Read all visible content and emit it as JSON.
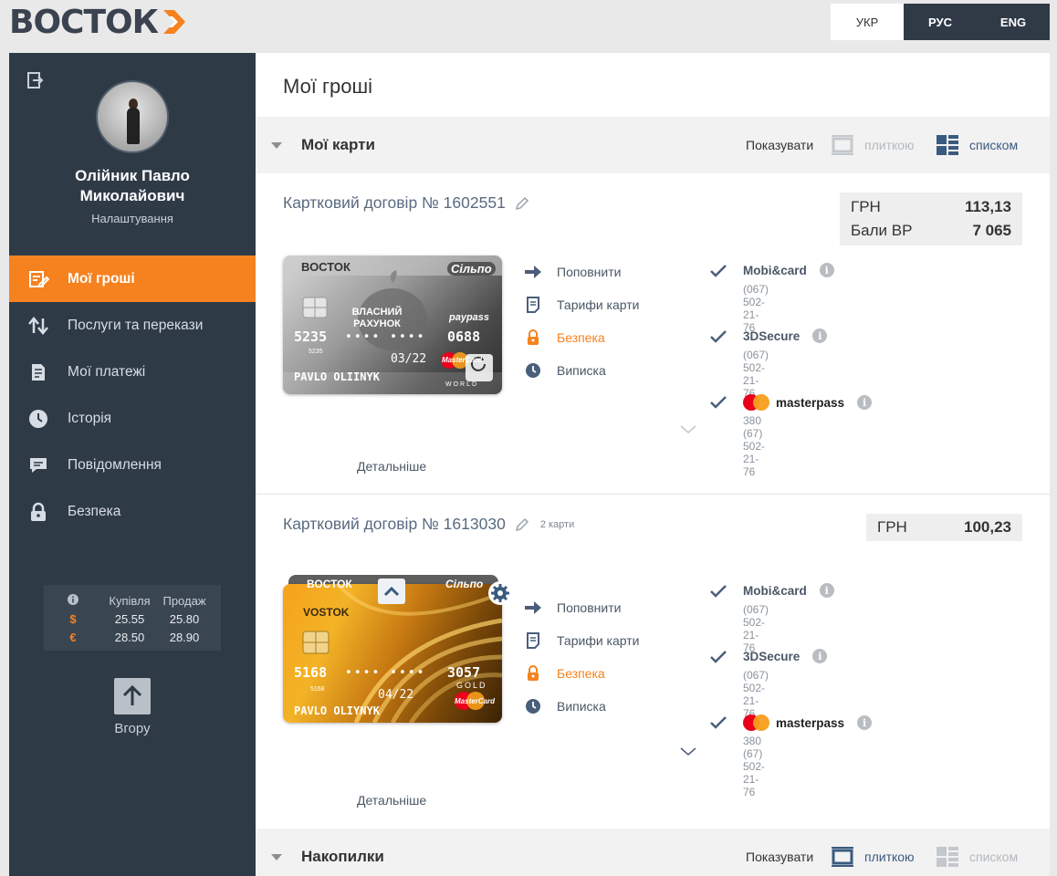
{
  "header": {
    "logo_text": "ВОСТОК",
    "languages": [
      {
        "label": "УКР",
        "active": true
      },
      {
        "label": "РУС",
        "active": false
      },
      {
        "label": "ENG",
        "active": false
      }
    ]
  },
  "sidebar": {
    "user_name_line1": "Олійник Павло",
    "user_name_line2": "Миколайович",
    "settings_label": "Налаштування",
    "nav": [
      {
        "label": "Мої гроші",
        "icon": "money-icon",
        "active": true
      },
      {
        "label": "Послуги та перекази",
        "icon": "transfer-icon",
        "active": false
      },
      {
        "label": "Мої платежі",
        "icon": "payments-icon",
        "active": false
      },
      {
        "label": "Історія",
        "icon": "clock-icon",
        "active": false
      },
      {
        "label": "Повідомлення",
        "icon": "message-icon",
        "active": false
      },
      {
        "label": "Безпека",
        "icon": "lock-icon",
        "active": false
      }
    ],
    "rates": {
      "buy_label": "Купівля",
      "sell_label": "Продаж",
      "rows": [
        {
          "currency": "$",
          "buy": "25.55",
          "sell": "25.80"
        },
        {
          "currency": "€",
          "buy": "28.50",
          "sell": "28.90"
        }
      ]
    },
    "up_label": "Вгору"
  },
  "main": {
    "page_title": "Мої гроші",
    "show_label": "Показувати",
    "tile_label": "плиткою",
    "list_label": "списком",
    "sections": {
      "cards_title": "Мої карти",
      "savings_title": "Накопилки"
    },
    "contracts": [
      {
        "title": "Картковий договір № 1602551",
        "cards_count": "",
        "balances": [
          {
            "label": "ГРН",
            "amount": "113,13"
          },
          {
            "label": "Бали ВР",
            "amount": "7 065"
          }
        ],
        "card": {
          "brand": "ВОСТОК",
          "partner": "Сільпо",
          "product": "ВЛАСНИЙ РАХУНОК",
          "paypass": "paypass",
          "number_first": "5235",
          "number_last": "0688",
          "bin_small": "5235",
          "valid_thru": "03/22",
          "holder": "PAVLO OLIINYK",
          "network": "MasterCard",
          "tier": "WORLD"
        },
        "actions": [
          "Поповнити",
          "Тарифи карти",
          "Безпека",
          "Виписка"
        ],
        "services": [
          {
            "name": "Mobi&card",
            "phone": "(067) 502-21-76"
          },
          {
            "name": "3DSecure",
            "phone": "(067) 502-21-76"
          },
          {
            "name": "masterpass",
            "phone": "380 (67) 502-21-76"
          }
        ],
        "details_label": "Детальніше"
      },
      {
        "title": "Картковий договір № 1613030",
        "cards_count": "2 карти",
        "balances": [
          {
            "label": "ГРН",
            "amount": "100,23"
          }
        ],
        "card": {
          "brand": "ВОСТОК",
          "brand_latin": "VOSTOK",
          "partner": "Сільпо",
          "number_first": "5168",
          "number_last": "3057",
          "bin_small": "5168",
          "valid_thru": "04/22",
          "holder": "PAVLO OLIYNYK",
          "network": "MasterCard",
          "tier": "GOLD"
        },
        "actions": [
          "Поповнити",
          "Тарифи карти",
          "Безпека",
          "Виписка"
        ],
        "services": [
          {
            "name": "Mobi&card",
            "phone": "(067) 502-21-76"
          },
          {
            "name": "3DSecure",
            "phone": "(067) 502-21-76"
          },
          {
            "name": "masterpass",
            "phone": "380 (67) 502-21-76"
          }
        ],
        "details_label": "Детальніше"
      }
    ]
  },
  "colors": {
    "accent": "#f5821f",
    "sidebar_bg": "#2f3a47",
    "text_link": "#5a6a80"
  }
}
